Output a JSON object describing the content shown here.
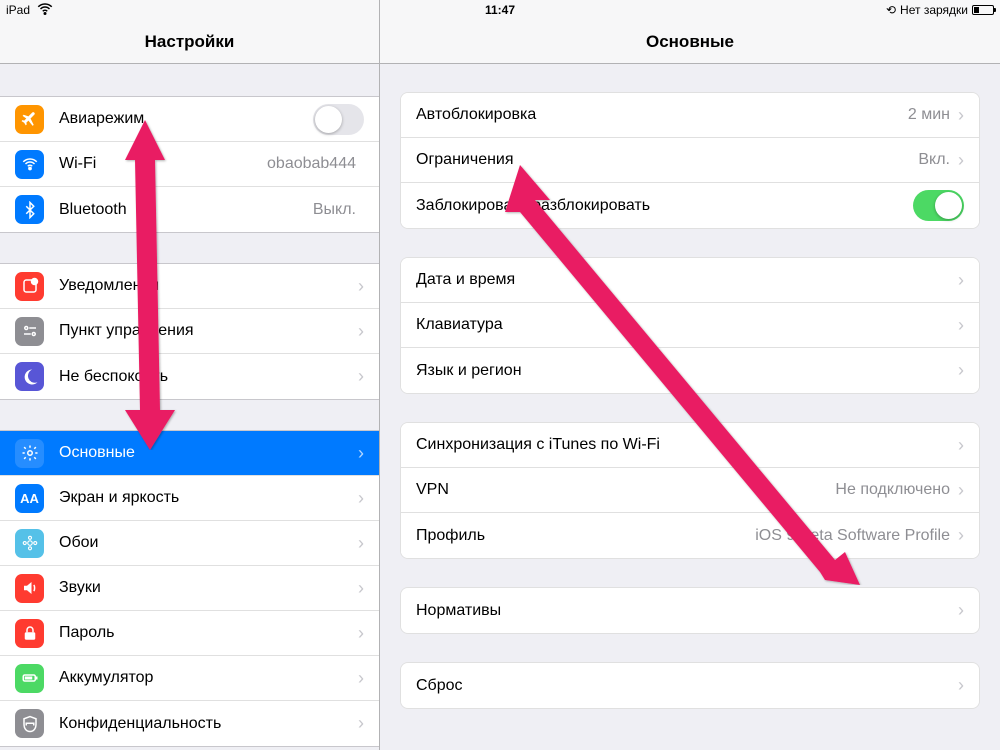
{
  "statusbar": {
    "device": "iPad",
    "time": "11:47",
    "charging_text": "Нет зарядки"
  },
  "left": {
    "title": "Настройки",
    "groups": [
      [
        {
          "icon": "airplane",
          "label": "Авиарежим",
          "accessory": "toggle",
          "toggle": false
        },
        {
          "icon": "wifi",
          "label": "Wi-Fi",
          "detail": "obaobab444",
          "accessory": "none"
        },
        {
          "icon": "bluetooth",
          "label": "Bluetooth",
          "detail": "Выкл.",
          "accessory": "none"
        }
      ],
      [
        {
          "icon": "notif",
          "label": "Уведомления",
          "accessory": "chevron"
        },
        {
          "icon": "control",
          "label": "Пункт управления",
          "accessory": "chevron"
        },
        {
          "icon": "dnd",
          "label": "Не беспокоить",
          "accessory": "chevron"
        }
      ],
      [
        {
          "icon": "general",
          "label": "Основные",
          "accessory": "chevron",
          "selected": true
        },
        {
          "icon": "display",
          "label": "Экран и яркость",
          "accessory": "chevron"
        },
        {
          "icon": "wallpaper",
          "label": "Обои",
          "accessory": "chevron"
        },
        {
          "icon": "sounds",
          "label": "Звуки",
          "accessory": "chevron"
        },
        {
          "icon": "passcode",
          "label": "Пароль",
          "accessory": "chevron"
        },
        {
          "icon": "battery",
          "label": "Аккумулятор",
          "accessory": "chevron"
        },
        {
          "icon": "privacy",
          "label": "Конфиденциальность",
          "accessory": "chevron"
        }
      ]
    ]
  },
  "right": {
    "title": "Основные",
    "groups": [
      [
        {
          "label": "Автоблокировка",
          "detail": "2 мин",
          "accessory": "chevron"
        },
        {
          "label": "Ограничения",
          "detail": "Вкл.",
          "accessory": "chevron"
        },
        {
          "label": "Заблокировать/разблокировать",
          "accessory": "toggle",
          "toggle": true
        }
      ],
      [
        {
          "label": "Дата и время",
          "accessory": "chevron"
        },
        {
          "label": "Клавиатура",
          "accessory": "chevron"
        },
        {
          "label": "Язык и регион",
          "accessory": "chevron"
        }
      ],
      [
        {
          "label": "Синхронизация с iTunes по Wi-Fi",
          "accessory": "chevron"
        },
        {
          "label": "VPN",
          "detail": "Не подключено",
          "accessory": "chevron"
        },
        {
          "label": "Профиль",
          "detail": "iOS 9 Beta Software Profile",
          "accessory": "chevron"
        }
      ],
      [
        {
          "label": "Нормативы",
          "accessory": "chevron"
        }
      ],
      [
        {
          "label": "Сброс",
          "accessory": "chevron"
        }
      ]
    ]
  },
  "icons": {
    "airplane": "✈",
    "wifi": "wifi",
    "bluetooth": "bt",
    "notif": "⬜",
    "control": "⊙",
    "dnd": "☾",
    "general": "⚙",
    "display": "AA",
    "wallpaper": "❋",
    "sounds": "🔊",
    "passcode": "🔒",
    "battery": "▮",
    "privacy": "✋"
  }
}
